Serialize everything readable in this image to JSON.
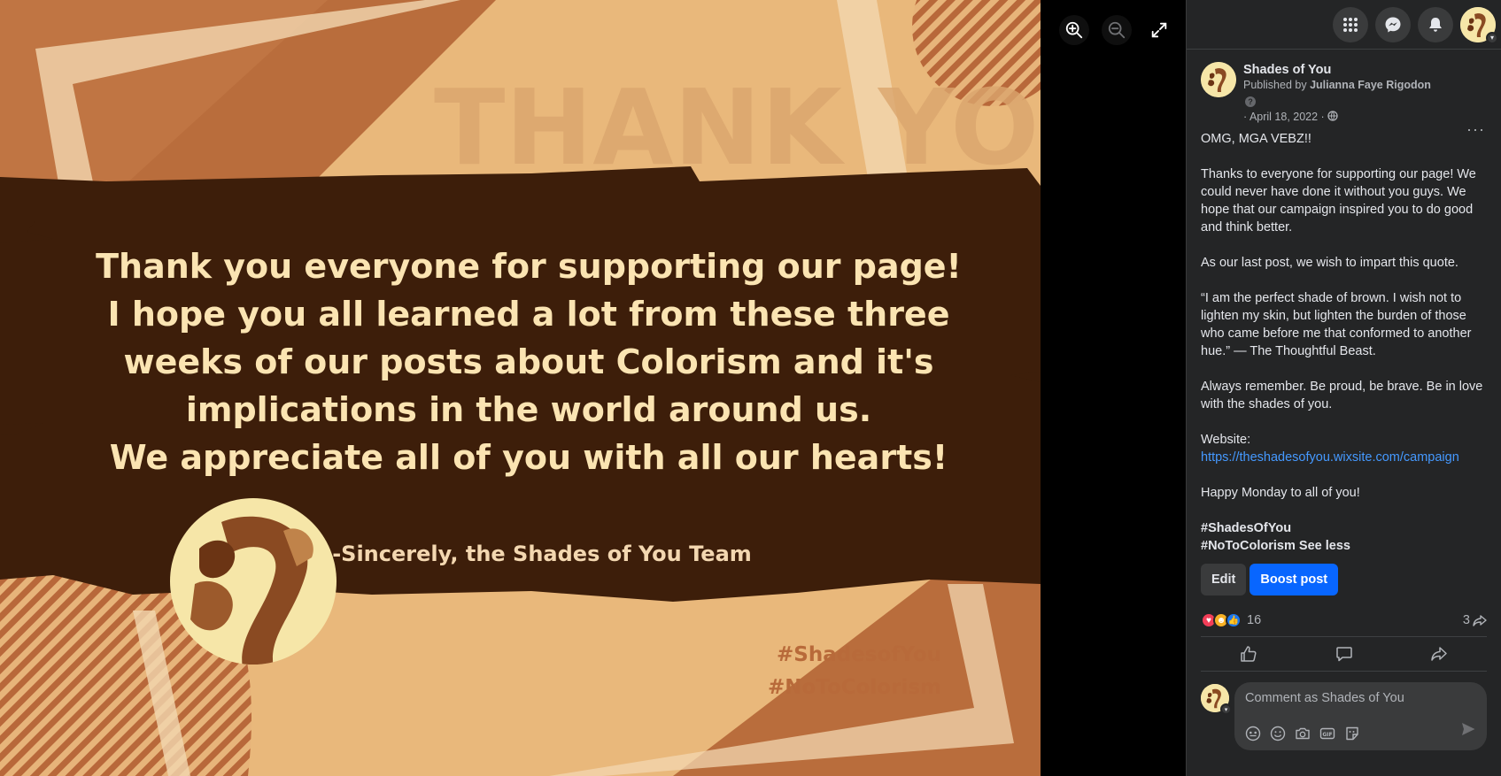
{
  "image": {
    "watermark": "THANK YOU!",
    "message_lines": [
      "Thank you everyone for supporting our page!",
      "I hope you all learned a lot from these three",
      "weeks of our posts about Colorism and it's",
      "implications in the world around us.",
      "We appreciate all of you with all our hearts!"
    ],
    "signature": "-Sincerely, the Shades of You Team",
    "hashtag1": "#ShadesofYou",
    "hashtag2": "#NoToColorism"
  },
  "viewer": {
    "icons": [
      "zoom-in-icon",
      "zoom-out-icon",
      "fullscreen-icon"
    ]
  },
  "topbar": {
    "icons": [
      "menu-grid-icon",
      "messenger-icon",
      "notifications-icon"
    ]
  },
  "post": {
    "page_name": "Shades of You",
    "published_by_prefix": "Published by",
    "publisher": "Julianna Faye Rigodon",
    "question_mark": "?",
    "date": "· April 18, 2022 ·",
    "more": "···",
    "paragraphs": [
      "OMG, MGA VEBZ!!",
      "Thanks to everyone for supporting our page! We could never have done it without you guys. We hope that our campaign inspired you to do good and think better.",
      "As our last post, we wish to impart this quote.",
      "“I am the perfect shade of brown. I wish not to lighten my skin, but lighten the burden of those who came before me that conformed to another hue.” — The Thoughtful Beast.",
      "Always remember. Be proud, be brave. Be in love with the shades of you."
    ],
    "website_label": "Website:",
    "website_url": "https://theshadesofyou.wixsite.com/campaign",
    "closing": "Happy Monday to all of you!",
    "tag1": "#ShadesOfYou",
    "tag2": "#NoToColorism",
    "see_less": "See less",
    "edit_label": "Edit",
    "boost_label": "Boost post",
    "reaction_count": "16",
    "share_count": "3",
    "comment_placeholder": "Comment as Shades of You"
  },
  "colors": {
    "accent": "#0866ff",
    "link": "#4599ff",
    "panel": "#242526",
    "poster_dark": "#3d1e0a",
    "poster_text": "#fbe4b2"
  }
}
